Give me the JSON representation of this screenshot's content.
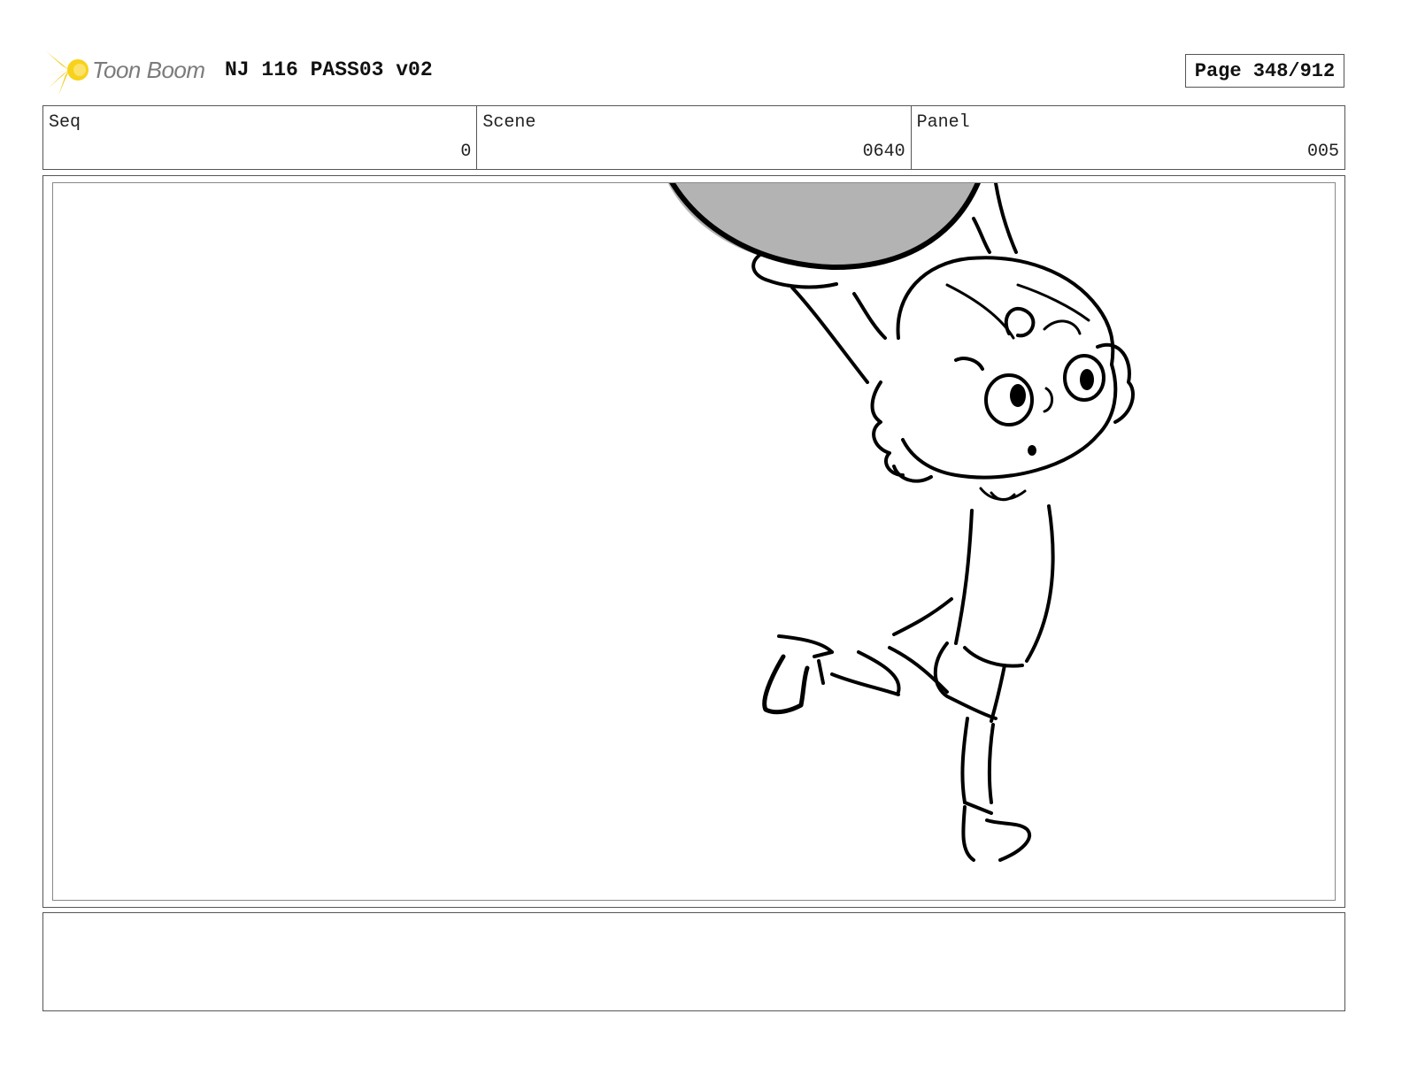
{
  "header": {
    "logo_text": "Toon Boom",
    "title": "NJ 116 PASS03 v02",
    "page_label": "Page 348/912"
  },
  "info": {
    "seq_label": "Seq",
    "seq_value": "0",
    "scene_label": "Scene",
    "scene_value": "0640",
    "panel_label": "Panel",
    "panel_value": "005"
  },
  "artwork": {
    "description_icon": "storyboard-sketch",
    "ball_color": "#b3b3b3"
  },
  "notes": {
    "text": ""
  }
}
